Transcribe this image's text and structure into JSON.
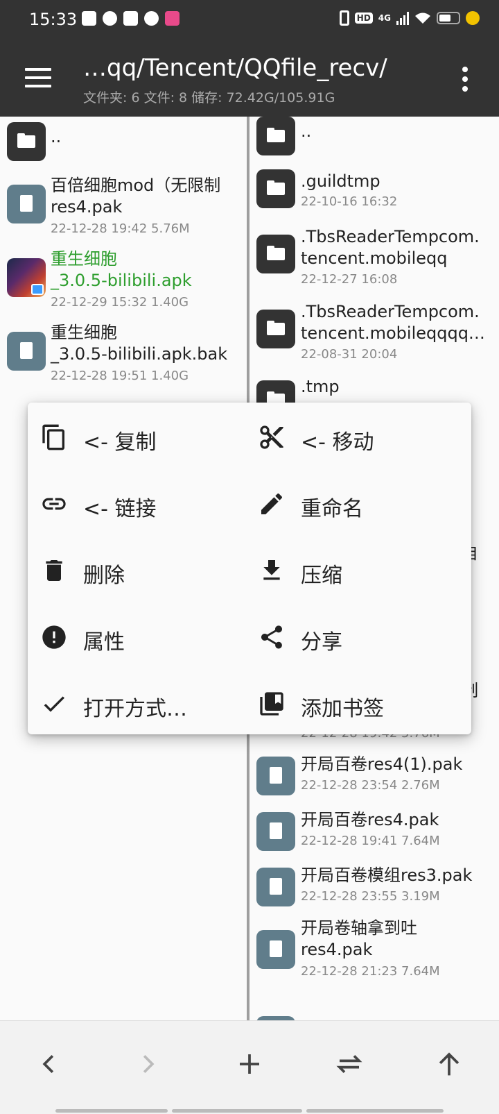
{
  "status": {
    "time": "15:33",
    "net": "4G"
  },
  "toolbar": {
    "path": "…qq/Tencent/QQfile_recv/",
    "stats": "文件夹: 6   文件: 8   储存: 72.42G/105.91G"
  },
  "left": {
    "parent": "..",
    "files": [
      {
        "line1": "百倍细胞mod（无限制",
        "line2": "res4.pak",
        "meta": "22-12-28 19:42  5.76M"
      },
      {
        "line1": "重生细胞",
        "line2": "_3.0.5-bilibili.apk",
        "meta": "22-12-29 15:32  1.40G"
      },
      {
        "line1": "重生细胞",
        "line2": "_3.0.5-bilibili.apk.bak",
        "meta": "22-12-28 19:51  1.40G"
      }
    ]
  },
  "right": {
    "parent": "..",
    "folders": [
      {
        "line1": ".guildtmp",
        "line2": "",
        "meta": "22-10-16 16:32"
      },
      {
        "line1": ".TbsReaderTempcom.",
        "line2": "tencent.mobileqq",
        "meta": "22-12-27 16:08"
      },
      {
        "line1": ".TbsReaderTempcom.",
        "line2": "tencent.mobileqqqq…",
        "meta": "22-08-31 20:04"
      },
      {
        "line1": ".tmp",
        "line2": "",
        "meta": ""
      }
    ],
    "partial": {
      "edge1": "自",
      "edge2": "岑",
      "edge3": "制",
      "meta": "22-12-28 19:42  5.76M"
    },
    "files": [
      {
        "line1": "开局百卷res4(1).pak",
        "line2": "",
        "meta": "22-12-28 23:54  2.76M"
      },
      {
        "line1": "开局百卷res4.pak",
        "line2": "",
        "meta": "22-12-28 19:41  7.64M"
      },
      {
        "line1": "开局百卷模组res3.pak",
        "line2": "",
        "meta": "22-12-28 23:55  3.19M"
      },
      {
        "line1": "开局卷轴拿到吐",
        "line2": "res4.pak",
        "meta": "22-12-28 21:23  7.64M"
      }
    ]
  },
  "menu": {
    "copy": "<- 复制",
    "move": "<- 移动",
    "link": "<- 链接",
    "rename": "重命名",
    "delete": "删除",
    "compress": "压缩",
    "properties": "属性",
    "share": "分享",
    "open_with": "打开方式…",
    "bookmark": "添加书签"
  },
  "colors": {
    "appbar": "#333333",
    "apk_text": "#2e9e2e",
    "file_icon": "#607d8b"
  }
}
